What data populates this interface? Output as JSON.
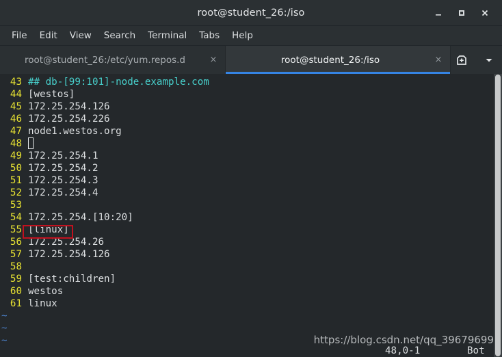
{
  "window": {
    "title": "root@student_26:/iso",
    "buttons": {
      "minimize": "minimize-icon",
      "maximize": "maximize-icon",
      "close": "close-icon"
    }
  },
  "menu": {
    "items": [
      {
        "label": "File"
      },
      {
        "label": "Edit"
      },
      {
        "label": "View"
      },
      {
        "label": "Search"
      },
      {
        "label": "Terminal"
      },
      {
        "label": "Tabs"
      },
      {
        "label": "Help"
      }
    ]
  },
  "tabs": {
    "items": [
      {
        "label": "root@student_26:/etc/yum.repos.d",
        "close": "×",
        "active": false
      },
      {
        "label": "root@student_26:/iso",
        "close": "×",
        "active": true
      }
    ],
    "new_tab_icon": "new-tab-icon",
    "dropdown_icon": "chevron-down-icon",
    "active_underline_color": "#3584e4"
  },
  "editor": {
    "lines": [
      {
        "no": "43",
        "text": "## db-[99:101]-node.example.com",
        "type": "comment"
      },
      {
        "no": "44",
        "text": "[westos]",
        "type": "normal"
      },
      {
        "no": "45",
        "text": "172.25.254.126",
        "type": "normal"
      },
      {
        "no": "46",
        "text": "172.25.254.226",
        "type": "normal"
      },
      {
        "no": "47",
        "text": "node1.westos.org",
        "type": "normal"
      },
      {
        "no": "48",
        "text": "",
        "type": "cursor"
      },
      {
        "no": "49",
        "text": "172.25.254.1",
        "type": "normal"
      },
      {
        "no": "50",
        "text": "172.25.254.2",
        "type": "normal"
      },
      {
        "no": "51",
        "text": "172.25.254.3",
        "type": "normal"
      },
      {
        "no": "52",
        "text": "172.25.254.4",
        "type": "normal"
      },
      {
        "no": "53",
        "text": "",
        "type": "normal"
      },
      {
        "no": "54",
        "text": "172.25.254.[10:20]",
        "type": "normal"
      },
      {
        "no": "55",
        "text": "[linux]",
        "type": "normal"
      },
      {
        "no": "56",
        "text": "172.25.254.26",
        "type": "normal"
      },
      {
        "no": "57",
        "text": "172.25.254.126",
        "type": "normal"
      },
      {
        "no": "58",
        "text": "",
        "type": "normal"
      },
      {
        "no": "59",
        "text": "[test:children]",
        "type": "normal"
      },
      {
        "no": "60",
        "text": "westos",
        "type": "normal"
      },
      {
        "no": "61",
        "text": "linux",
        "type": "normal"
      }
    ],
    "empty_markers": [
      "~",
      "~",
      "~"
    ],
    "annotation": {
      "target_line": "55",
      "color": "#c1121f"
    },
    "colors": {
      "background": "#24282b",
      "text": "#dcdfe1",
      "linenumber": "#e8e332",
      "comment": "#48d1cd",
      "tilde": "#4a7ec4"
    }
  },
  "status": {
    "position": "48,0-1",
    "location": "Bot"
  },
  "watermark": {
    "text": "https://blog.csdn.net/qq_39679699"
  }
}
